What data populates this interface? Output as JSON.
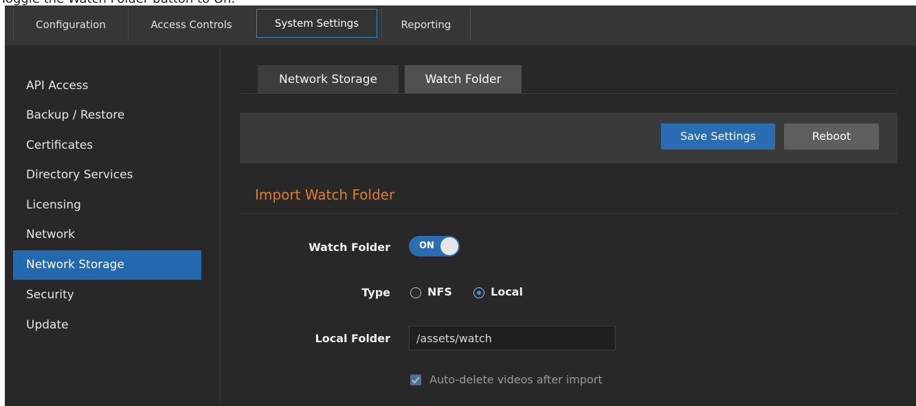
{
  "instruction": "Toggle the Watch Folder button to On.",
  "topnav": {
    "tabs": [
      {
        "label": "Configuration"
      },
      {
        "label": "Access Controls"
      },
      {
        "label": "System Settings"
      },
      {
        "label": "Reporting"
      }
    ],
    "active": "System Settings"
  },
  "sidebar": {
    "items": [
      {
        "label": "API Access"
      },
      {
        "label": "Backup / Restore"
      },
      {
        "label": "Certificates"
      },
      {
        "label": "Directory Services"
      },
      {
        "label": "Licensing"
      },
      {
        "label": "Network"
      },
      {
        "label": "Network Storage"
      },
      {
        "label": "Security"
      },
      {
        "label": "Update"
      }
    ],
    "active": "Network Storage"
  },
  "subtabs": {
    "items": [
      {
        "label": "Network Storage"
      },
      {
        "label": "Watch Folder"
      }
    ],
    "active": "Watch Folder"
  },
  "toolbar": {
    "save_label": "Save Settings",
    "reboot_label": "Reboot"
  },
  "section": {
    "title": "Import Watch Folder"
  },
  "form": {
    "watch_folder_label": "Watch Folder",
    "watch_folder_toggle": "ON",
    "type_label": "Type",
    "type_options": [
      {
        "label": "NFS",
        "checked": false
      },
      {
        "label": "Local",
        "checked": true
      }
    ],
    "local_folder_label": "Local Folder",
    "local_folder_value": "/assets/watch",
    "auto_delete_label": "Auto-delete videos after import",
    "auto_delete_checked": true
  },
  "colors": {
    "accent": "#2b6db3",
    "section_title": "#e07b32",
    "background": "#282828"
  }
}
